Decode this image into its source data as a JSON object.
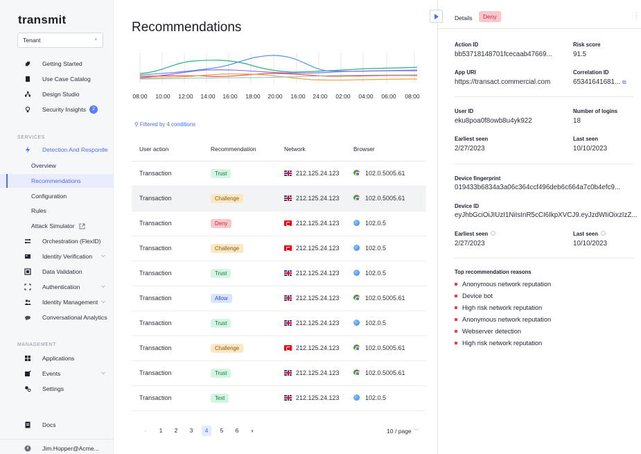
{
  "app": {
    "logo_text": "transmit"
  },
  "sidebar": {
    "tenant": "Tenant",
    "items_top": [
      {
        "label": "Getting Started",
        "icon": "rocket-icon"
      },
      {
        "label": "Use Case Catalog",
        "icon": "book-icon"
      },
      {
        "label": "Design Studio",
        "icon": "hierarchy-icon"
      },
      {
        "label": "Security Insights",
        "icon": "bulb-icon",
        "badge": "2"
      }
    ],
    "services_label": "SERVICES",
    "detection": "Detection And Response",
    "detection_sub": [
      "Overview",
      "Recommendations",
      "Configuration",
      "Rules",
      "Attack Simulator"
    ],
    "services": [
      {
        "label": "Orchestration (FlexID)",
        "icon": "flow-icon"
      },
      {
        "label": "Identity Verification",
        "icon": "id-card-icon"
      },
      {
        "label": "Data Validation",
        "icon": "data-icon"
      },
      {
        "label": "Authentication",
        "icon": "scan-icon"
      },
      {
        "label": "Identity Management",
        "icon": "users-icon"
      },
      {
        "label": "Conversational Analytics",
        "icon": "chat-icon"
      }
    ],
    "management_label": "MANAGEMENT",
    "management": [
      {
        "label": "Applications",
        "icon": "apps-icon"
      },
      {
        "label": "Events",
        "icon": "events-icon"
      },
      {
        "label": "Settings",
        "icon": "gear-icon"
      }
    ],
    "docs": "Docs",
    "user": "Jim.Hopper@Acme..."
  },
  "main": {
    "title": "Recommendations",
    "filter": "Filtered by 4 conditions",
    "chart_ticks": [
      "08:00",
      "10:00",
      "12:00",
      "14:00",
      "16:00",
      "18:00",
      "20:00",
      "16:00",
      "24:00",
      "02:00",
      "04:00",
      "06:00",
      "08:00"
    ],
    "columns": [
      "User action",
      "Recommendation",
      "Network",
      "Browser"
    ],
    "rows": [
      {
        "action": "Transaction",
        "rec": "Trust",
        "flag": "uk",
        "ip": "212.125.24.123",
        "browser": "chrome",
        "ver": "102.0.5005.61"
      },
      {
        "action": "Transaction",
        "rec": "Challenge",
        "flag": "uk",
        "ip": "212.125.24.123",
        "browser": "chrome",
        "ver": "102.0.5005.61"
      },
      {
        "action": "Transaction",
        "rec": "Deny",
        "flag": "tr",
        "ip": "212.125.24.123",
        "browser": "other",
        "ver": "102.0.5"
      },
      {
        "action": "Transaction",
        "rec": "Challenge",
        "flag": "tr",
        "ip": "212.125.24.123",
        "browser": "other",
        "ver": "102.0.5"
      },
      {
        "action": "Transaction",
        "rec": "Trust",
        "flag": "uk",
        "ip": "212.125.24.123",
        "browser": "other",
        "ver": "102.0.5"
      },
      {
        "action": "Transaction",
        "rec": "Allow",
        "flag": "uk",
        "ip": "212.125.24.123",
        "browser": "chrome",
        "ver": "102.0.5005.61"
      },
      {
        "action": "Transaction",
        "rec": "Trust",
        "flag": "uk",
        "ip": "212.125.24.123",
        "browser": "other",
        "ver": "102.0.5"
      },
      {
        "action": "Transaction",
        "rec": "Challenge",
        "flag": "tr",
        "ip": "212.125.24.123",
        "browser": "chrome",
        "ver": "102.0.5005.61"
      },
      {
        "action": "Transaction",
        "rec": "Trust",
        "flag": "uk",
        "ip": "212.125.24.123",
        "browser": "chrome",
        "ver": "102.0.5005.61"
      },
      {
        "action": "Transaction",
        "rec": "Text",
        "flag": "uk",
        "ip": "212.125.24.123",
        "browser": "other",
        "ver": "102.0.5"
      }
    ],
    "pages": [
      "1",
      "2",
      "3",
      "4",
      "5",
      "6"
    ],
    "current_page": "4",
    "per_page": "10 / page"
  },
  "details": {
    "title": "Details",
    "tag": "Deny",
    "action_id_label": "Action ID",
    "action_id": "bb53718148701fcecaab47669...",
    "risk_label": "Risk score",
    "risk": "91.5",
    "app_uri_label": "App URI",
    "app_uri": "https://transact.commercial.com",
    "corr_label": "Correlation ID",
    "corr": "65341641681...",
    "user_id_label": "User ID",
    "user_id": "eku8poa0f8owb8u4yk922",
    "logins_label": "Number of logins",
    "logins": "18",
    "earliest_label": "Earliest seen",
    "earliest": "2/27/2023",
    "last_label": "Last seen",
    "last": "10/10/2023",
    "fp_label": "Device fingerprint",
    "fp": "019433b6834a3a06c364ccf496deb6c664a7c0b4efc9...",
    "device_label": "Device ID",
    "device": "eyJhbGciOiJIUzI1NiIsInR5cCI6IkpXVCJ9.eyJzdWIiOixzIzZ...",
    "earliest2_label": "Earliest seen",
    "earliest2": "2/27/2023",
    "last2_label": "Last seen",
    "last2": "10/10/2023",
    "reasons_title": "Top recommendation reasons",
    "reasons": [
      "Anonymous network reputation",
      "Device bot",
      "High risk network reputation",
      "Anonymous network reputation",
      "Webserver detection",
      "High risk network reputation"
    ]
  },
  "colors": {
    "accent": "#4c6ef5",
    "trust": "#d3f5e2",
    "challenge": "#fde7c2",
    "deny": "#f9c7cb",
    "allow": "#d6e4ff"
  }
}
